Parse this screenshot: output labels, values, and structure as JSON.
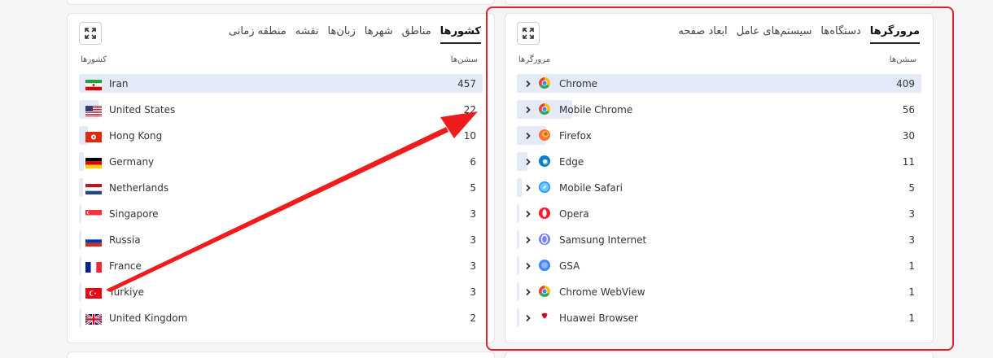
{
  "countries_panel": {
    "tabs": [
      "کشورها",
      "مناطق",
      "شهرها",
      "زبان‌ها",
      "نقشه",
      "منطقه زمانی"
    ],
    "col_sessions": "سشن‌ها",
    "col_name": "کشورها",
    "rows": [
      {
        "name": "Iran",
        "value": "457",
        "fraction": 1.0,
        "flag": "iran-flag-icon"
      },
      {
        "name": "United States",
        "value": "22",
        "fraction": 0.048,
        "flag": "us-flag-icon"
      },
      {
        "name": "Hong Kong",
        "value": "10",
        "fraction": 0.022,
        "flag": "hong-kong-flag-icon"
      },
      {
        "name": "Germany",
        "value": "6",
        "fraction": 0.013,
        "flag": "germany-flag-icon"
      },
      {
        "name": "Netherlands",
        "value": "5",
        "fraction": 0.011,
        "flag": "netherlands-flag-icon"
      },
      {
        "name": "Singapore",
        "value": "3",
        "fraction": 0.007,
        "flag": "singapore-flag-icon"
      },
      {
        "name": "Russia",
        "value": "3",
        "fraction": 0.007,
        "flag": "russia-flag-icon"
      },
      {
        "name": "France",
        "value": "3",
        "fraction": 0.007,
        "flag": "france-flag-icon"
      },
      {
        "name": "Türkiye",
        "value": "3",
        "fraction": 0.007,
        "flag": "turkey-flag-icon"
      },
      {
        "name": "United Kingdom",
        "value": "2",
        "fraction": 0.004,
        "flag": "uk-flag-icon"
      }
    ]
  },
  "browsers_panel": {
    "tabs": [
      "مرورگرها",
      "دستگاه‌ها",
      "سیستم‌های عامل",
      "ابعاد صفحه"
    ],
    "col_sessions": "سشن‌ها",
    "col_name": "مرورگرها",
    "rows": [
      {
        "name": "Chrome",
        "value": "409",
        "fraction": 1.0,
        "icon": "chrome-icon"
      },
      {
        "name": "Mobile Chrome",
        "value": "56",
        "fraction": 0.137,
        "icon": "chrome-icon"
      },
      {
        "name": "Firefox",
        "value": "30",
        "fraction": 0.073,
        "icon": "firefox-icon"
      },
      {
        "name": "Edge",
        "value": "11",
        "fraction": 0.027,
        "icon": "edge-icon"
      },
      {
        "name": "Mobile Safari",
        "value": "5",
        "fraction": 0.012,
        "icon": "safari-icon"
      },
      {
        "name": "Opera",
        "value": "3",
        "fraction": 0.007,
        "icon": "opera-icon"
      },
      {
        "name": "Samsung Internet",
        "value": "3",
        "fraction": 0.007,
        "icon": "samsung-internet-icon"
      },
      {
        "name": "GSA",
        "value": "1",
        "fraction": 0.002,
        "icon": "gsa-icon"
      },
      {
        "name": "Chrome WebView",
        "value": "1",
        "fraction": 0.002,
        "icon": "chrome-icon"
      },
      {
        "name": "Huawei Browser",
        "value": "1",
        "fraction": 0.002,
        "icon": "huawei-icon"
      }
    ]
  },
  "colors": {
    "bar": "#e5eaf9",
    "highlight": "#e0232f",
    "arrow": "#ee1c1c"
  }
}
